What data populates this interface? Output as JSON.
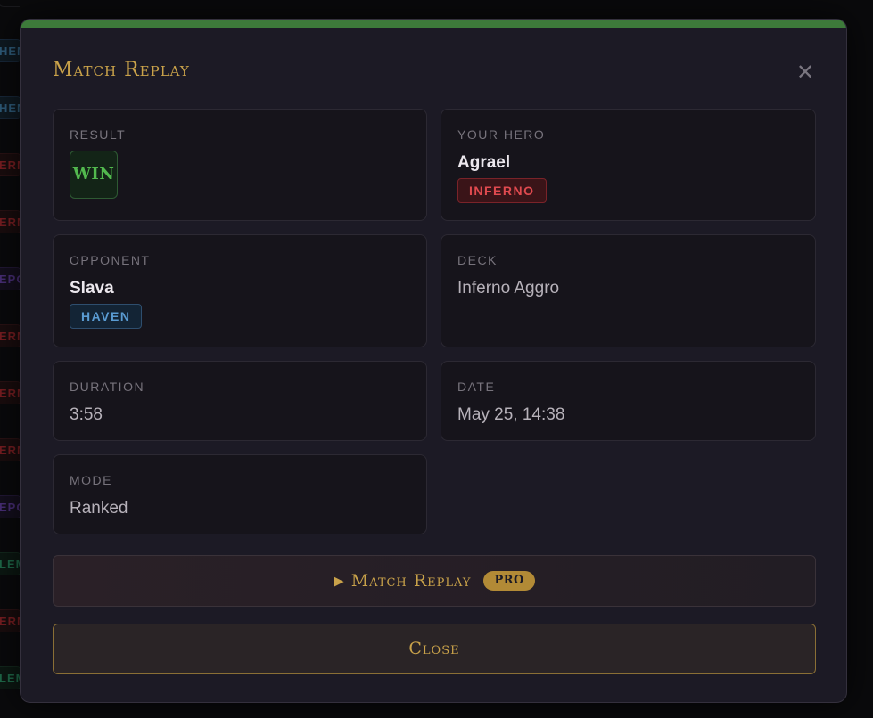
{
  "modal": {
    "title": "Match Replay",
    "accent_color": "#3d7a3a",
    "title_color": "#c9a24a"
  },
  "background": {
    "tags": [
      {
        "text": "HEN",
        "faction": "haven"
      },
      {
        "text": "HEN",
        "faction": "haven"
      },
      {
        "text": "ERNO",
        "faction": "inferno"
      },
      {
        "text": "ERNO",
        "faction": "inferno"
      },
      {
        "text": "EPO",
        "faction": "necro"
      },
      {
        "text": "ERNO",
        "faction": "inferno"
      },
      {
        "text": "ERNO",
        "faction": "inferno"
      },
      {
        "text": "ERNO",
        "faction": "inferno"
      },
      {
        "text": "EPO",
        "faction": "necro"
      },
      {
        "text": "LEM",
        "faction": "sylvan"
      },
      {
        "text": "ERNO",
        "faction": "inferno"
      },
      {
        "text": "LEM",
        "faction": "sylvan"
      }
    ]
  },
  "result": {
    "label": "Result",
    "value": "WIN"
  },
  "hero": {
    "label": "Your Hero",
    "name": "Agrael",
    "faction": "INFERNO"
  },
  "opponent": {
    "label": "Opponent",
    "name": "Slava",
    "faction": "HAVEN"
  },
  "deck": {
    "label": "Deck",
    "value": "Inferno Aggro"
  },
  "duration": {
    "label": "Duration",
    "value": "3:58"
  },
  "date": {
    "label": "Date",
    "value": "May 25, 14:38"
  },
  "mode": {
    "label": "Mode",
    "value": "Ranked"
  },
  "actions": {
    "replay_icon": "play-icon",
    "replay_label": "Match Replay",
    "pro_badge": "PRO",
    "close_label": "Close"
  }
}
